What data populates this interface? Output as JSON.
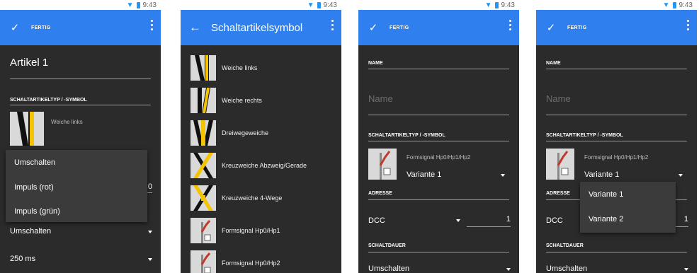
{
  "statusbar": {
    "time": "9:43"
  },
  "screen1": {
    "action": "FERTIG",
    "name_value": "Artikel 1",
    "section_label": "SCHALTARTIKELTYP / -SYMBOL",
    "symbol_label": "Weiche links",
    "menu_items": [
      "Umschalten",
      "Impuls (rot)",
      "Impuls (grün)"
    ],
    "partial_value": "0",
    "row1_value": "Umschalten",
    "row2_value": "250 ms"
  },
  "screen2": {
    "title": "Schaltartikelsymbol",
    "items": [
      "Weiche links",
      "Weiche rechts",
      "Dreiwegeweiche",
      "Kreuzweiche Abzweig/Gerade",
      "Kreuzweiche 4-Wege",
      "Formsignal Hp0/Hp1",
      "Formsignal Hp0/Hp2"
    ]
  },
  "screen3": {
    "action": "FERTIG",
    "name_label": "NAME",
    "name_placeholder": "Name",
    "section_label": "SCHALTARTIKELTYP / -SYMBOL",
    "symbol_label": "Formsignal Hp0/Hp1/Hp2",
    "variant_value": "Variante 1",
    "address_label": "ADRESSE",
    "protocol_value": "DCC",
    "address_value": "1",
    "duration_label": "SCHALTDAUER",
    "duration_value": "Umschalten"
  },
  "screen4": {
    "action": "FERTIG",
    "name_label": "NAME",
    "name_placeholder": "Name",
    "section_label": "SCHALTARTIKELTYP / -SYMBOL",
    "symbol_label": "Formsignal Hp0/Hp1/Hp2",
    "variant_value": "Variante 1",
    "address_label": "ADRESSE",
    "menu_items": [
      "Variante 1",
      "Variante 2"
    ],
    "protocol_value": "DCC",
    "address_value": "1",
    "duration_label": "SCHALTDAUER",
    "duration_value": "Umschalten"
  },
  "colors": {
    "actionbar": "#2f80ee",
    "background": "#2b2b2b",
    "accent_yellow": "#f5c400"
  }
}
